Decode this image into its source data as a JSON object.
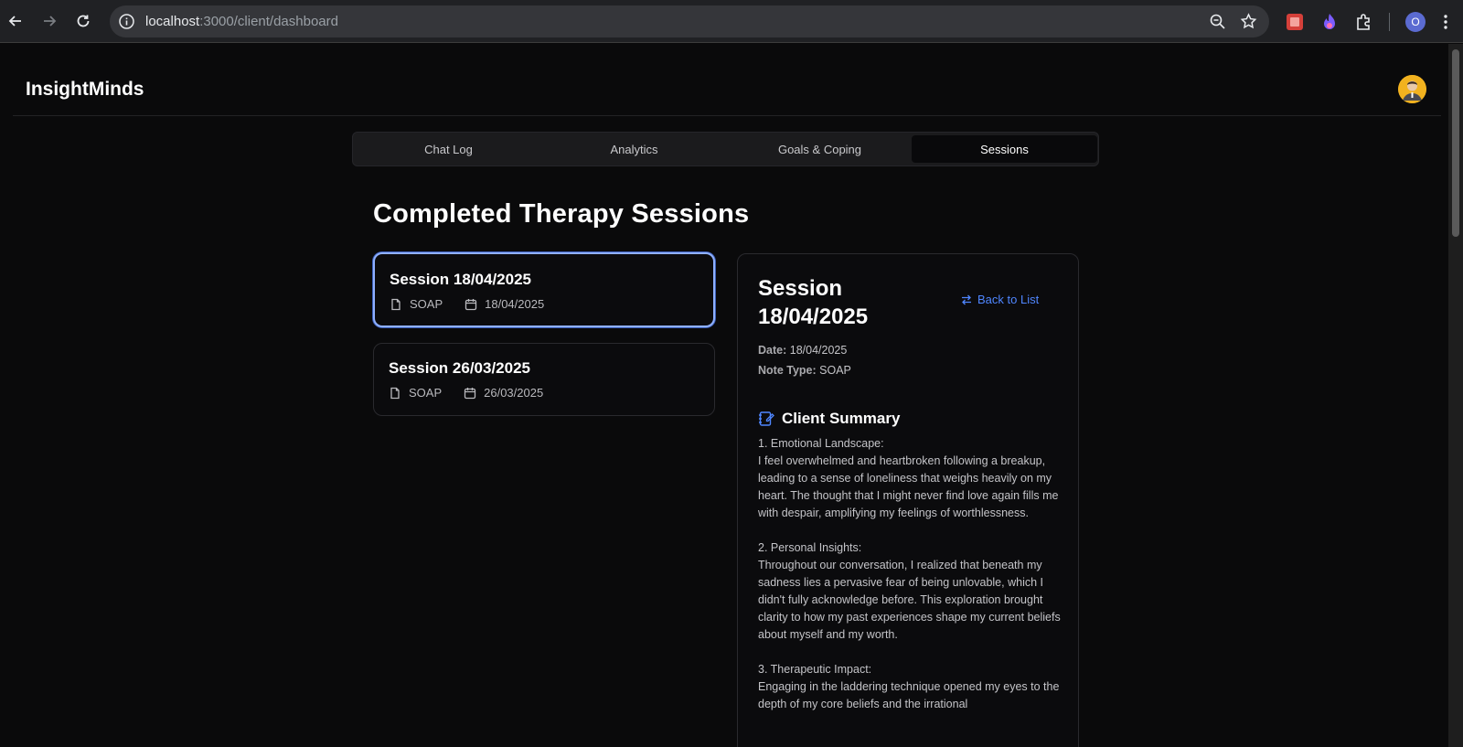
{
  "browser": {
    "url_host": "localhost",
    "url_path": ":3000/client/dashboard",
    "profile_initial": "O"
  },
  "app": {
    "brand": "InsightMinds"
  },
  "tabs": [
    {
      "label": "Chat Log",
      "active": false
    },
    {
      "label": "Analytics",
      "active": false
    },
    {
      "label": "Goals & Coping",
      "active": false
    },
    {
      "label": "Sessions",
      "active": true
    }
  ],
  "sessions_page": {
    "title": "Completed Therapy Sessions",
    "list": [
      {
        "title": "Session 18/04/2025",
        "note_type": "SOAP",
        "date": "18/04/2025",
        "selected": true
      },
      {
        "title": "Session 26/03/2025",
        "note_type": "SOAP",
        "date": "26/03/2025",
        "selected": false
      }
    ]
  },
  "detail": {
    "title": "Session 18/04/2025",
    "back_label": "Back to List",
    "date_label": "Date:",
    "date_value": "18/04/2025",
    "note_type_label": "Note Type:",
    "note_type_value": "SOAP",
    "summary_heading": "Client Summary",
    "summary_paragraphs": [
      "1. Emotional Landscape:\nI feel overwhelmed and heartbroken following a breakup, leading to a sense of loneliness that weighs heavily on my heart. The thought that I might never find love again fills me with despair, amplifying my feelings of worthlessness.",
      "2. Personal Insights:\nThroughout our conversation, I realized that beneath my sadness lies a pervasive fear of being unlovable, which I didn't fully acknowledge before. This exploration brought clarity to how my past experiences shape my current beliefs about myself and my worth.",
      "3. Therapeutic Impact:\nEngaging in the laddering technique opened my eyes to the depth of my core beliefs and the irrational"
    ]
  },
  "colors": {
    "accent": "#4f86ff",
    "selected_border": "#8fb0ff",
    "background": "#0a0a0b"
  }
}
